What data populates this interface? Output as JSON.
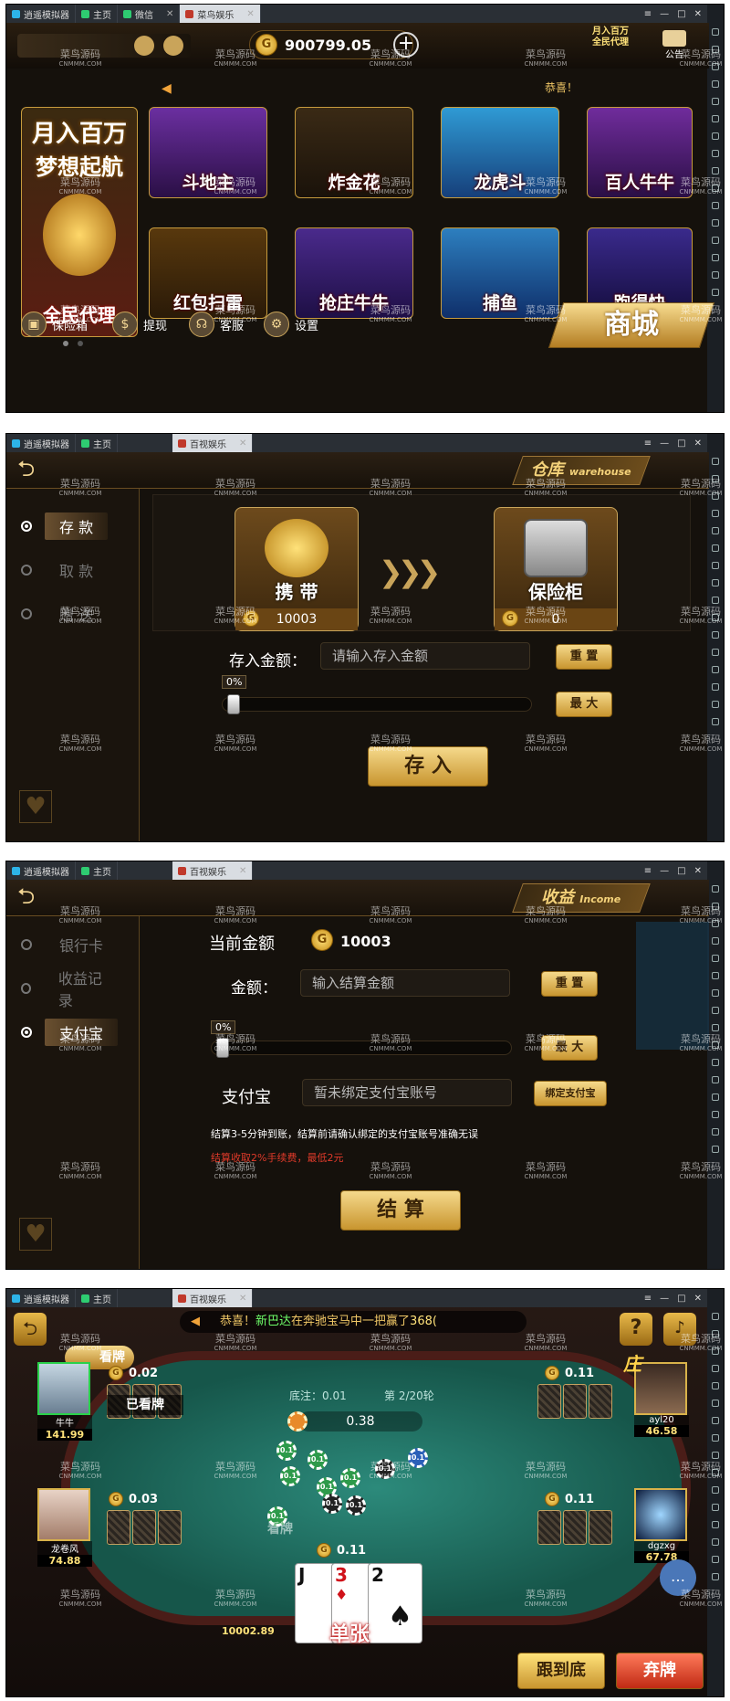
{
  "window_tabs": [
    {
      "label": "逍遥模拟器"
    },
    {
      "label": "主页"
    },
    {
      "label": "微信"
    },
    {
      "label": "菜鸟娱乐"
    }
  ],
  "window_tabs_game": [
    {
      "label": "逍遥模拟器"
    },
    {
      "label": "主页"
    },
    {
      "label": "百视娱乐"
    }
  ],
  "watermark": {
    "line1": "菜鸟源码",
    "line2": "CNMMM.COM"
  },
  "lobby": {
    "balance": "900799.05",
    "top_right": {
      "promo": "月入百万全民代理",
      "notice": "公告"
    },
    "marquee_text": "恭喜！",
    "promo_banner": {
      "headline1": "月入百万",
      "headline2": "梦想起航",
      "caption": "全民代理"
    },
    "games": [
      {
        "label": "斗地主"
      },
      {
        "label": "炸金花"
      },
      {
        "label": "龙虎斗"
      },
      {
        "label": "百人牛牛"
      },
      {
        "label": "红包扫雷"
      },
      {
        "label": "抢庄牛牛"
      },
      {
        "label": "捕鱼"
      },
      {
        "label": "跑得快"
      }
    ],
    "bottom": [
      {
        "label": "保险箱"
      },
      {
        "label": "提现"
      },
      {
        "label": "客服"
      },
      {
        "label": "设置"
      }
    ],
    "shop": "商城"
  },
  "warehouse": {
    "title": "仓库",
    "title_en": "warehouse",
    "nav": [
      {
        "label": "存 款",
        "active": true
      },
      {
        "label": "取 款",
        "active": false
      },
      {
        "label": "赠 送",
        "active": false
      }
    ],
    "carry_label": "携 带",
    "carry_amount": "10003",
    "safe_label": "保险柜",
    "safe_amount": "0",
    "amount_label": "存入金额：",
    "amount_placeholder": "请输入存入金额",
    "reset": "重 置",
    "max": "最 大",
    "percent": "0%",
    "submit": "存 入"
  },
  "income": {
    "title": "收益",
    "title_en": "Income",
    "nav": [
      {
        "label": "银行卡",
        "active": false
      },
      {
        "label": "收益记录",
        "active": false
      },
      {
        "label": "支付宝",
        "active": true
      }
    ],
    "current_label": "当前金额",
    "current_amount": "10003",
    "amount_label": "金额：",
    "amount_placeholder": "输入结算金额",
    "reset": "重 置",
    "max": "最 大",
    "percent": "0%",
    "alipay_label": "支付宝",
    "alipay_placeholder": "暂未绑定支付宝账号",
    "bind": "绑定支付宝",
    "note1": "结算3-5分钟到账，结算前请确认绑定的支付宝账号准确无误",
    "note2": "结算收取2%手续费，最低2元",
    "submit": "结 算"
  },
  "table": {
    "ticker": {
      "prefix": "恭喜！",
      "name": "新巴达",
      "mid": "在奔驰宝马中一把赢了",
      "amount": "368("
    },
    "look_btn": "看牌",
    "base_bet": "底注：0.01",
    "round": "第 2/20轮",
    "pot": "0.38",
    "banker": "庄",
    "players": [
      {
        "name": "牛牛",
        "money": "141.99",
        "bet": "0.02",
        "status": "已看牌"
      },
      {
        "name": "ayl20",
        "money": "46.58",
        "bet": "0.11"
      },
      {
        "name": "龙卷风",
        "money": "74.88",
        "bet": "0.03"
      },
      {
        "name": "dgzxg",
        "money": "67.78",
        "bet": "0.11"
      }
    ],
    "self_bet": "0.11",
    "self_money": "10002.89",
    "self_status": "看牌",
    "hand": [
      "J",
      "3",
      "2"
    ],
    "hand_type": "单张",
    "chip_values": [
      "0.1",
      "0.1",
      "0.1",
      "0.1",
      "0.1",
      "0.1",
      "0.1",
      "0.1",
      "0.1",
      "0.1"
    ],
    "follow_btn": "跟到底",
    "fold_btn": "弃牌"
  },
  "colors": {
    "gold": "#f2d593",
    "felt": "#1f7466",
    "accent_red": "#e03a2a"
  }
}
